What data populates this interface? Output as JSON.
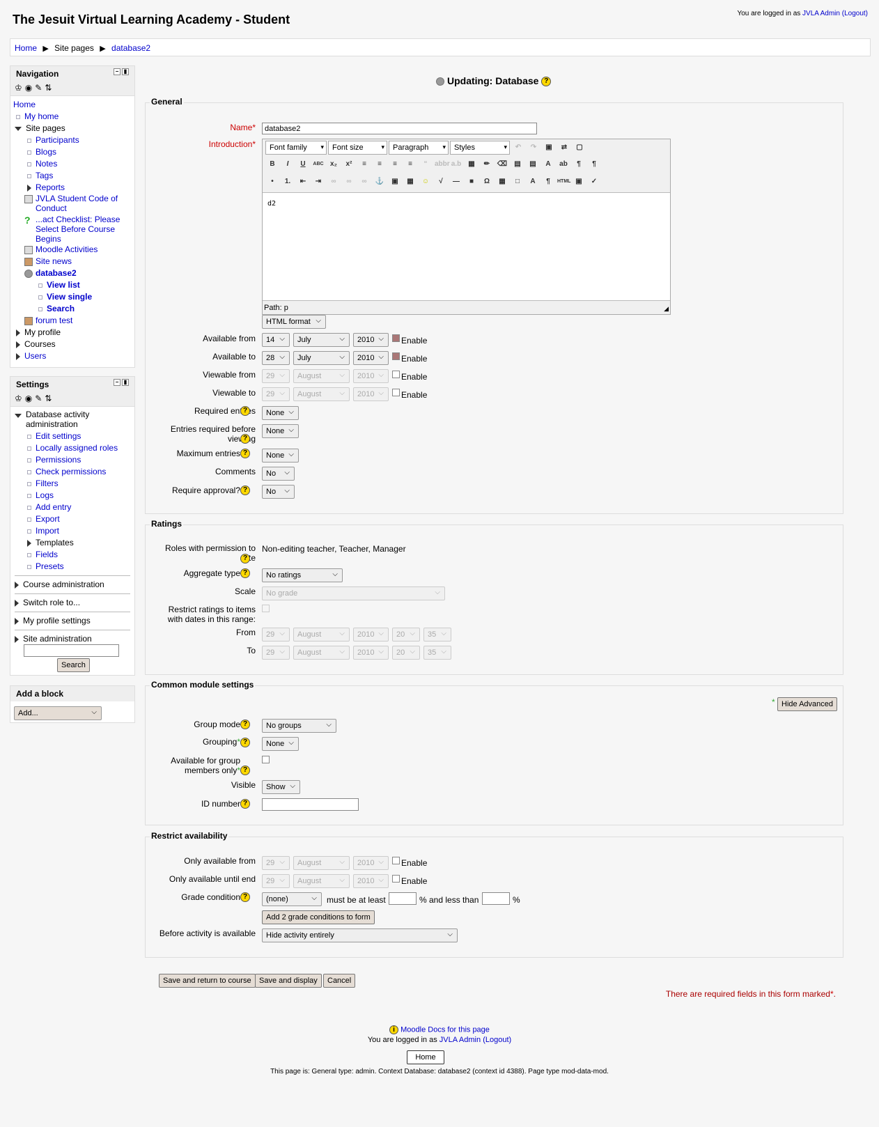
{
  "site_title": "The Jesuit Virtual Learning Academy - Student",
  "login": {
    "prefix": "You are logged in as",
    "user": "JVLA Admin",
    "logout": "(Logout)"
  },
  "breadcrumb": [
    "Home",
    "Site pages",
    "database2"
  ],
  "navigation": {
    "title": "Navigation",
    "home": "Home",
    "my_home": "My home",
    "site_pages": "Site pages",
    "participants": "Participants",
    "blogs": "Blogs",
    "notes": "Notes",
    "tags": "Tags",
    "reports": "Reports",
    "code_of_conduct": "JVLA Student Code of Conduct",
    "checklist": "...act Checklist: Please Select Before Course Begins",
    "moodle_activities": "Moodle Activities",
    "site_news": "Site news",
    "database2": "database2",
    "view_list": "View list",
    "view_single": "View single",
    "search": "Search",
    "forum_test": "forum test",
    "my_profile": "My profile",
    "courses": "Courses",
    "users": "Users"
  },
  "settings": {
    "title": "Settings",
    "db_admin": "Database activity administration",
    "items": [
      "Edit settings",
      "Locally assigned roles",
      "Permissions",
      "Check permissions",
      "Filters",
      "Logs",
      "Add entry",
      "Export",
      "Import"
    ],
    "templates": "Templates",
    "fields": "Fields",
    "presets": "Presets",
    "course_admin": "Course administration",
    "switch_role": "Switch role to...",
    "my_profile_settings": "My profile settings",
    "site_admin": "Site administration",
    "search_button": "Search"
  },
  "add_block": {
    "title": "Add a block",
    "select": "Add..."
  },
  "heading": "Updating: Database",
  "general": {
    "legend": "General",
    "name_label": "Name",
    "name_value": "database2",
    "intro_label": "Introduction",
    "font_family": "Font family",
    "font_size": "Font size",
    "paragraph": "Paragraph",
    "styles": "Styles",
    "editor_content": "d2",
    "path": "Path:",
    "path_value": "p",
    "format": "HTML format",
    "available_from": "Available from",
    "available_to": "Available to",
    "viewable_from": "Viewable from",
    "viewable_to": "Viewable to",
    "enable": "Enable",
    "af": {
      "day": "14",
      "month": "July",
      "year": "2010"
    },
    "at": {
      "day": "28",
      "month": "July",
      "year": "2010"
    },
    "vf": {
      "day": "29",
      "month": "August",
      "year": "2010"
    },
    "vt": {
      "day": "29",
      "month": "August",
      "year": "2010"
    },
    "required_entries": "Required entries",
    "entries_before_viewing": "Entries required before viewing",
    "maximum_entries": "Maximum entries",
    "comments": "Comments",
    "require_approval": "Require approval?",
    "none": "None",
    "no": "No"
  },
  "ratings": {
    "legend": "Ratings",
    "roles_label": "Roles with permission to rate",
    "roles_value": "Non-editing teacher, Teacher, Manager",
    "aggregate_label": "Aggregate type",
    "aggregate_value": "No ratings",
    "scale_label": "Scale",
    "scale_value": "No grade",
    "restrict_label": "Restrict ratings to items with dates in this range:",
    "from": "From",
    "to": "To",
    "day": "29",
    "month": "August",
    "year": "2010",
    "hour": "20",
    "minute": "35"
  },
  "common": {
    "legend": "Common module settings",
    "hide_advanced": "Hide Advanced",
    "group_mode": "Group mode",
    "group_mode_value": "No groups",
    "grouping": "Grouping",
    "grouping_value": "None",
    "group_members_only": "Available for group members only",
    "visible": "Visible",
    "visible_value": "Show",
    "id_number": "ID number"
  },
  "restrict": {
    "legend": "Restrict availability",
    "only_from": "Only available from",
    "only_until": "Only available until end",
    "day": "29",
    "month": "August",
    "year": "2010",
    "enable": "Enable",
    "grade_condition": "Grade condition",
    "grade_value": "(none)",
    "must_be": "must be at least",
    "less_than": "% and less than",
    "pct": "%",
    "add_conditions": "Add 2 grade conditions to form",
    "before_label": "Before activity is available",
    "before_value": "Hide activity entirely"
  },
  "buttons": {
    "save_return": "Save and return to course",
    "save_display": "Save and display",
    "cancel": "Cancel"
  },
  "required_note": "There are required fields in this form marked",
  "footer": {
    "docs": "Moodle Docs for this page",
    "logged_in": "You are logged in as",
    "user": "JVLA Admin",
    "logout": "(Logout)",
    "home": "Home",
    "page_info": "This page is: General type: admin. Context Database: database2 (context id 4388). Page type mod-data-mod."
  }
}
